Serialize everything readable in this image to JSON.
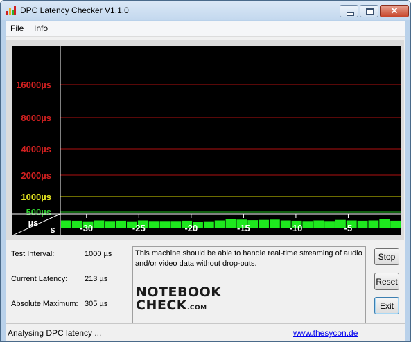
{
  "window": {
    "title": "DPC Latency Checker V1.1.0"
  },
  "menu": {
    "items": [
      "File",
      "Info"
    ]
  },
  "chart_data": {
    "type": "bar",
    "y_ticks": [
      {
        "label": "16000µs",
        "color": "#d22020",
        "line_color": "#b01010"
      },
      {
        "label": "8000µs",
        "color": "#d22020",
        "line_color": "#b01010"
      },
      {
        "label": "4000µs",
        "color": "#d22020",
        "line_color": "#b01010"
      },
      {
        "label": "2000µs",
        "color": "#d22020",
        "line_color": "#b01010"
      },
      {
        "label": "1000µs",
        "color": "#e8e820",
        "line_color": "#d8d800"
      },
      {
        "label": "500µs",
        "color": "#30d030",
        "line_color": "#20c020"
      }
    ],
    "ylabel": "µs",
    "xlabel": "s",
    "x_ticks": [
      -30,
      -25,
      -20,
      -15,
      -10,
      -5
    ],
    "x_range": [
      -32.5,
      0
    ],
    "bar_color": "#1ee81e",
    "values": [
      240,
      230,
      210,
      240,
      220,
      230,
      210,
      240,
      220,
      220,
      220,
      230,
      200,
      210,
      240,
      280,
      270,
      250,
      260,
      270,
      240,
      230,
      220,
      240,
      220,
      260,
      240,
      230,
      240,
      300,
      230
    ]
  },
  "stats": [
    {
      "label": "Test Interval:",
      "value": "1000 µs"
    },
    {
      "label": "Current Latency:",
      "value": "213 µs"
    },
    {
      "label": "Absolute Maximum:",
      "value": "305 µs"
    }
  ],
  "message": "This machine should be able to handle real-time streaming of audio and/or video data without drop-outs.",
  "logo": {
    "line1": "NOTEBOOK",
    "line2": "CHECK",
    "suffix": ".COM"
  },
  "buttons": {
    "stop": "Stop",
    "reset": "Reset",
    "exit": "Exit"
  },
  "status": {
    "text": "Analysing DPC latency ...",
    "link": "www.thesycon.de"
  }
}
